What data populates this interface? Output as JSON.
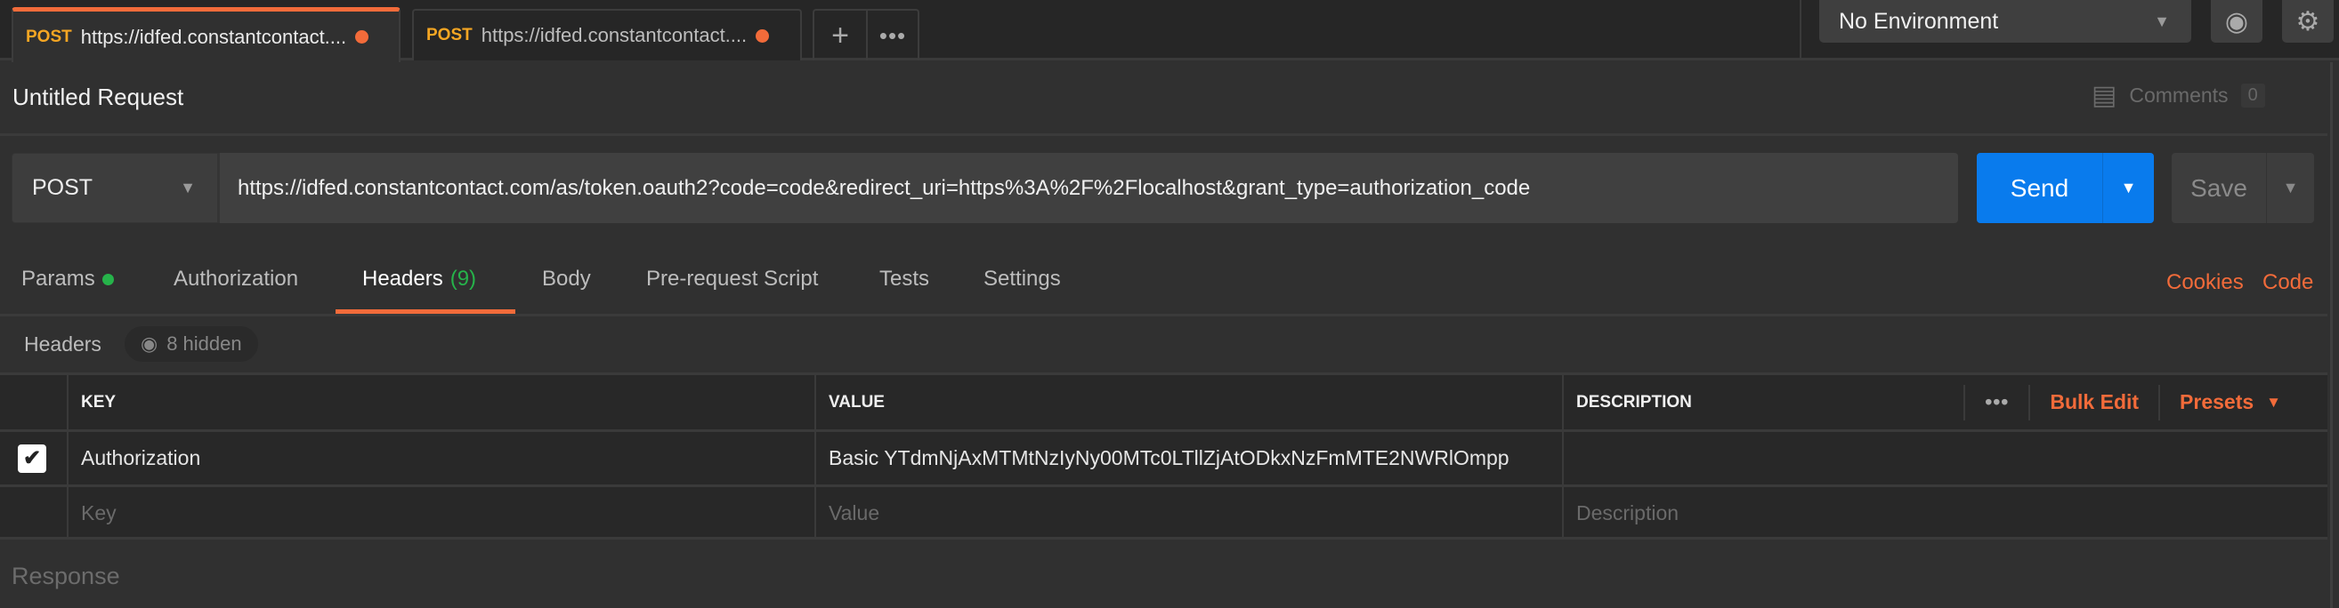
{
  "tabs": [
    {
      "method": "POST",
      "url": "https://idfed.constantcontact....",
      "active": true,
      "unsaved": true
    },
    {
      "method": "POST",
      "url": "https://idfed.constantcontact....",
      "active": false,
      "unsaved": true
    }
  ],
  "environment": {
    "selected": "No Environment"
  },
  "request": {
    "title": "Untitled Request",
    "comments_label": "Comments",
    "comments_count": "0",
    "method": "POST",
    "url": "https://idfed.constantcontact.com/as/token.oauth2?code=code&redirect_uri=https%3A%2F%2Flocalhost&grant_type=authorization_code",
    "send_label": "Send",
    "save_label": "Save"
  },
  "req_tabs": [
    {
      "label": "Params"
    },
    {
      "label": "Authorization"
    },
    {
      "label": "Headers",
      "count": "(9)",
      "active": true
    },
    {
      "label": "Body"
    },
    {
      "label": "Pre-request Script"
    },
    {
      "label": "Tests"
    },
    {
      "label": "Settings"
    }
  ],
  "links": {
    "cookies": "Cookies",
    "code": "Code"
  },
  "headers_section": {
    "label": "Headers",
    "hidden": "8 hidden"
  },
  "table": {
    "columns": [
      "KEY",
      "VALUE",
      "DESCRIPTION"
    ],
    "bulk_edit": "Bulk Edit",
    "presets": "Presets",
    "rows": [
      {
        "checked": true,
        "key": "Authorization",
        "value": "Basic YTdmNjAxMTMtNzIyNy00MTc0LTllZjAtODkxNzFmMTE2NWRlOmpp",
        "description": ""
      }
    ],
    "placeholders": {
      "key": "Key",
      "value": "Value",
      "description": "Description"
    }
  },
  "response_label": "Response",
  "colors": {
    "accent": "#f26b3a",
    "send": "#097bed",
    "method": "#f5a623",
    "success": "#26b34a"
  }
}
